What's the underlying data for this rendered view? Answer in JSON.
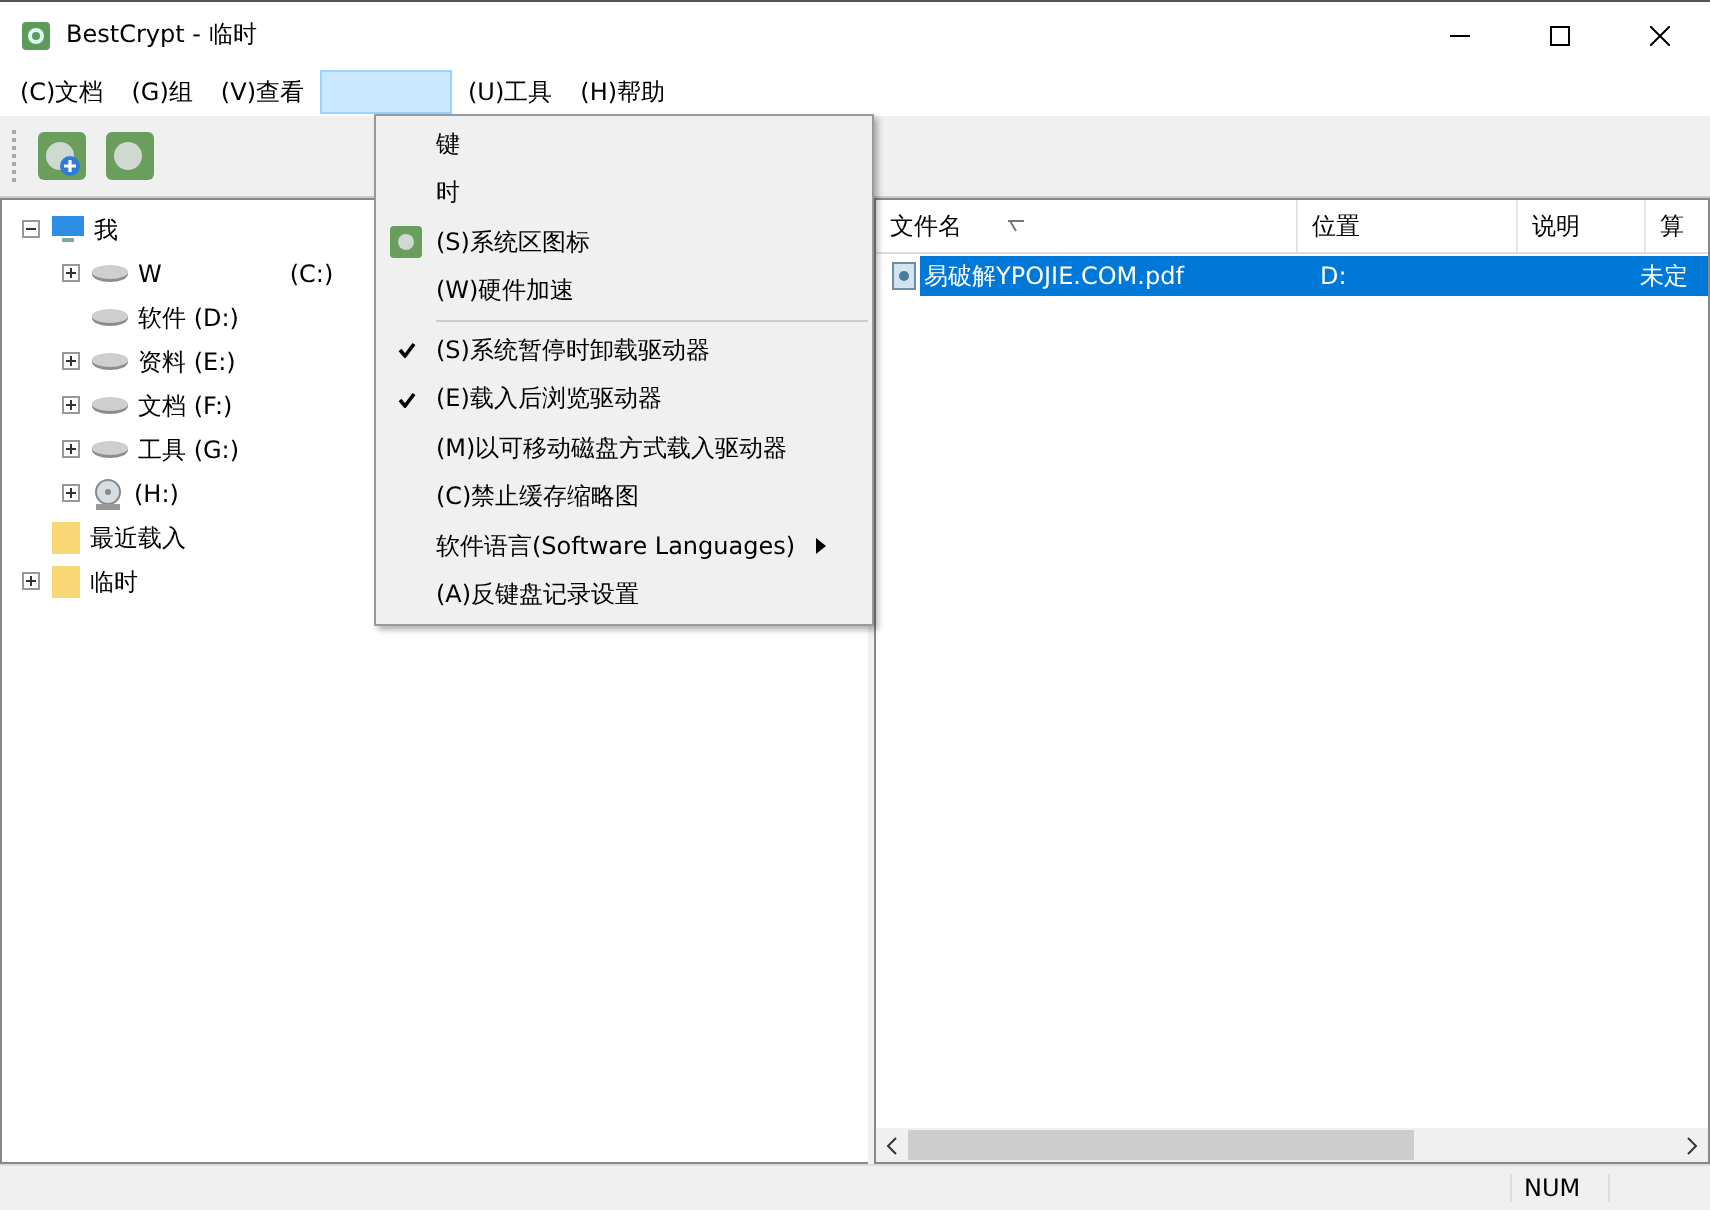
{
  "window": {
    "title": "BestCrypt - 临时"
  },
  "menu_bar": [
    {
      "label": "(C)文档",
      "selected": false
    },
    {
      "label": "(G)组",
      "selected": false
    },
    {
      "label": "(V)查看",
      "selected": false
    },
    {
      "selected": true
    },
    {
      "label": "(U)工具",
      "selected": false
    },
    {
      "label": "(H)帮助",
      "selected": false
    }
  ],
  "dropdown": [
    {
      "kind": "item",
      "label": "键",
      "checked": false,
      "icon": false
    },
    {
      "kind": "item",
      "label": "时",
      "checked": false,
      "icon": false
    },
    {
      "kind": "item",
      "label": "(S)系统区图标",
      "checked": false,
      "icon": true
    },
    {
      "kind": "item",
      "label": "(W)硬件加速",
      "checked": false,
      "icon": false
    },
    {
      "kind": "separator"
    },
    {
      "kind": "item",
      "label": "(S)系统暂停时卸载驱动器",
      "checked": true,
      "icon": false
    },
    {
      "kind": "item",
      "label": "(E)载入后浏览驱动器",
      "checked": true,
      "icon": false
    },
    {
      "kind": "item",
      "label": "(M)以可移动磁盘方式载入驱动器",
      "checked": false,
      "icon": false
    },
    {
      "kind": "item",
      "label": "(C)禁止缓存缩略图",
      "checked": false,
      "icon": false
    },
    {
      "kind": "submenu",
      "label": "软件语言(Software Languages)",
      "checked": false,
      "icon": false
    },
    {
      "kind": "item",
      "label": "(A)反键盘记录设置",
      "checked": false,
      "icon": false
    }
  ],
  "tree": [
    {
      "kind": "computer",
      "label": "我",
      "expandable": true,
      "expanded": true,
      "children": [
        {
          "kind": "drive",
          "label": "W",
          "tail": "(C:)",
          "expandable": true,
          "expanded": false
        },
        {
          "kind": "drive",
          "label": "软件 (D:)",
          "expandable": false
        },
        {
          "kind": "drive",
          "label": "资料 (E:)",
          "expandable": true,
          "expanded": false
        },
        {
          "kind": "drive",
          "label": "文档 (F:)",
          "expandable": true,
          "expanded": false
        },
        {
          "kind": "drive",
          "label": "工具 (G:)",
          "expandable": true,
          "expanded": false
        },
        {
          "kind": "cdrom",
          "label": "(H:)",
          "expandable": true,
          "expanded": false
        }
      ]
    },
    {
      "kind": "folder",
      "label": "最近载入",
      "expandable": false
    },
    {
      "kind": "folder",
      "label": "临时",
      "expandable": true,
      "expanded": false
    }
  ],
  "table": {
    "columns": [
      "文件名",
      "位置",
      "说明",
      "算"
    ],
    "rows": [
      {
        "selected": true,
        "cells": [
          "易破解YPOJIE.COM.pdf",
          "D:",
          "",
          "未定"
        ]
      }
    ]
  },
  "status_bar": {
    "indicator": "NUM"
  }
}
